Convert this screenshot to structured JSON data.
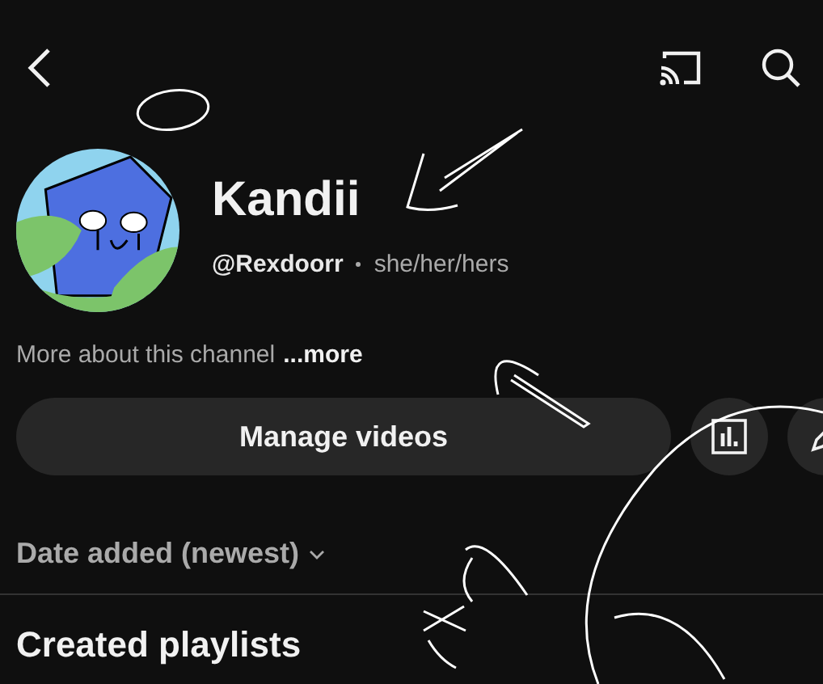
{
  "channel": {
    "name": "Kandii",
    "handle": "@Rexdoorr",
    "pronouns": "she/her/hers",
    "description": "More about this channel",
    "more_link": "...more"
  },
  "actions": {
    "primary": "Manage videos"
  },
  "sort": {
    "label": "Date added (newest)"
  },
  "section": {
    "title": "Created playlists"
  }
}
